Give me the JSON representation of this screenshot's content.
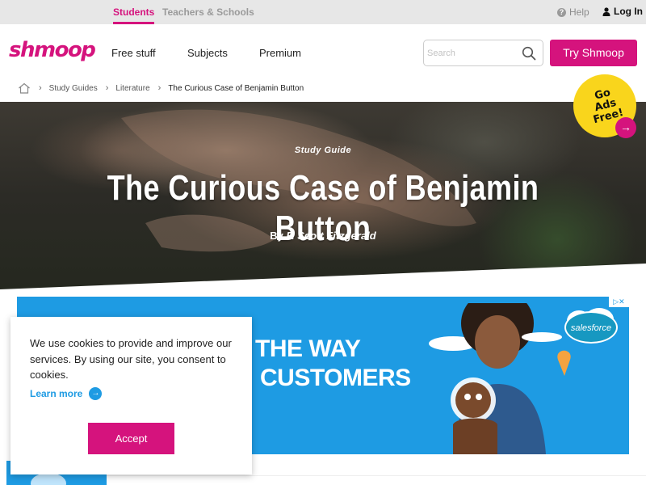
{
  "topbar": {
    "tab_students": "Students",
    "tab_teachers": "Teachers & Schools",
    "help": "Help",
    "login": "Log In"
  },
  "header": {
    "logo": "shmoop",
    "nav": [
      "Free stuff",
      "Subjects",
      "Premium"
    ],
    "search_placeholder": "Search",
    "cta": "Try Shmoop"
  },
  "breadcrumb": [
    "Study Guides",
    "Literature",
    "The Curious Case of Benjamin Button"
  ],
  "hero": {
    "kicker": "Study Guide",
    "title": "The Curious Case of Benjamin Button",
    "by": "By",
    "author": "F. Scott Fitzgerald"
  },
  "badge": {
    "line1": "Go",
    "line2": "Ads Free!"
  },
  "ad": {
    "line1": "THE WAY",
    "line2": "CUSTOMERS",
    "brand": "salesforce"
  },
  "cookie": {
    "message": "We use cookies to provide and improve our services. By using our site, you consent to cookies.",
    "learn_more": "Learn more",
    "accept": "Accept"
  },
  "colors": {
    "brand_pink": "#d5137d",
    "ad_blue": "#1e9be3",
    "badge_yellow": "#f9d51c"
  }
}
